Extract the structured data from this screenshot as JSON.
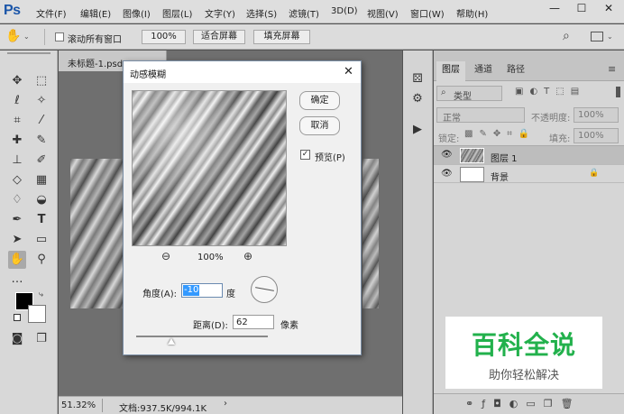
{
  "app": {
    "logo": "Ps"
  },
  "menu": [
    "文件(F)",
    "编辑(E)",
    "图像(I)",
    "图层(L)",
    "文字(Y)",
    "选择(S)",
    "滤镜(T)",
    "3D(D)",
    "视图(V)",
    "窗口(W)",
    "帮助(H)"
  ],
  "window_controls": {
    "minimize": "—",
    "maximize": "☐",
    "close": "✕"
  },
  "options_bar": {
    "scroll_all_label": "滚动所有窗口",
    "zoom_button": "100%",
    "fit_screen_button": "适合屏幕",
    "fill_screen_button": "填充屏幕"
  },
  "document": {
    "tab_title": "未标题-1.psd",
    "zoom": "51.32%",
    "doc_info": "文档:937.5K/994.1K"
  },
  "dialog": {
    "title": "动感模糊",
    "ok": "确定",
    "cancel": "取消",
    "preview_label": "预览(P)",
    "preview_checked": true,
    "preview_zoom": "100%",
    "angle_label": "角度(A):",
    "angle_value": "-10",
    "angle_unit": "度",
    "distance_label": "距离(D):",
    "distance_value": "62",
    "distance_unit": "像素",
    "slider_level": 0.27
  },
  "layers_panel": {
    "tabs": [
      "图层",
      "通道",
      "路径"
    ],
    "filter_label": "类型",
    "blend_mode": "正常",
    "opacity_label": "不透明度:",
    "opacity_value": "100%",
    "lock_label": "锁定:",
    "fill_label": "填充:",
    "fill_value": "100%",
    "layers": [
      {
        "name": "图层 1",
        "selected": true
      },
      {
        "name": "背景",
        "selected": false,
        "locked": true
      }
    ]
  },
  "watermark": {
    "title": "百科全说",
    "subtitle": "助你轻松解决"
  },
  "colors": {
    "accent_blue": "#1a55a8",
    "watermark_green": "#22b14c",
    "selection_blue": "#3399ff"
  }
}
